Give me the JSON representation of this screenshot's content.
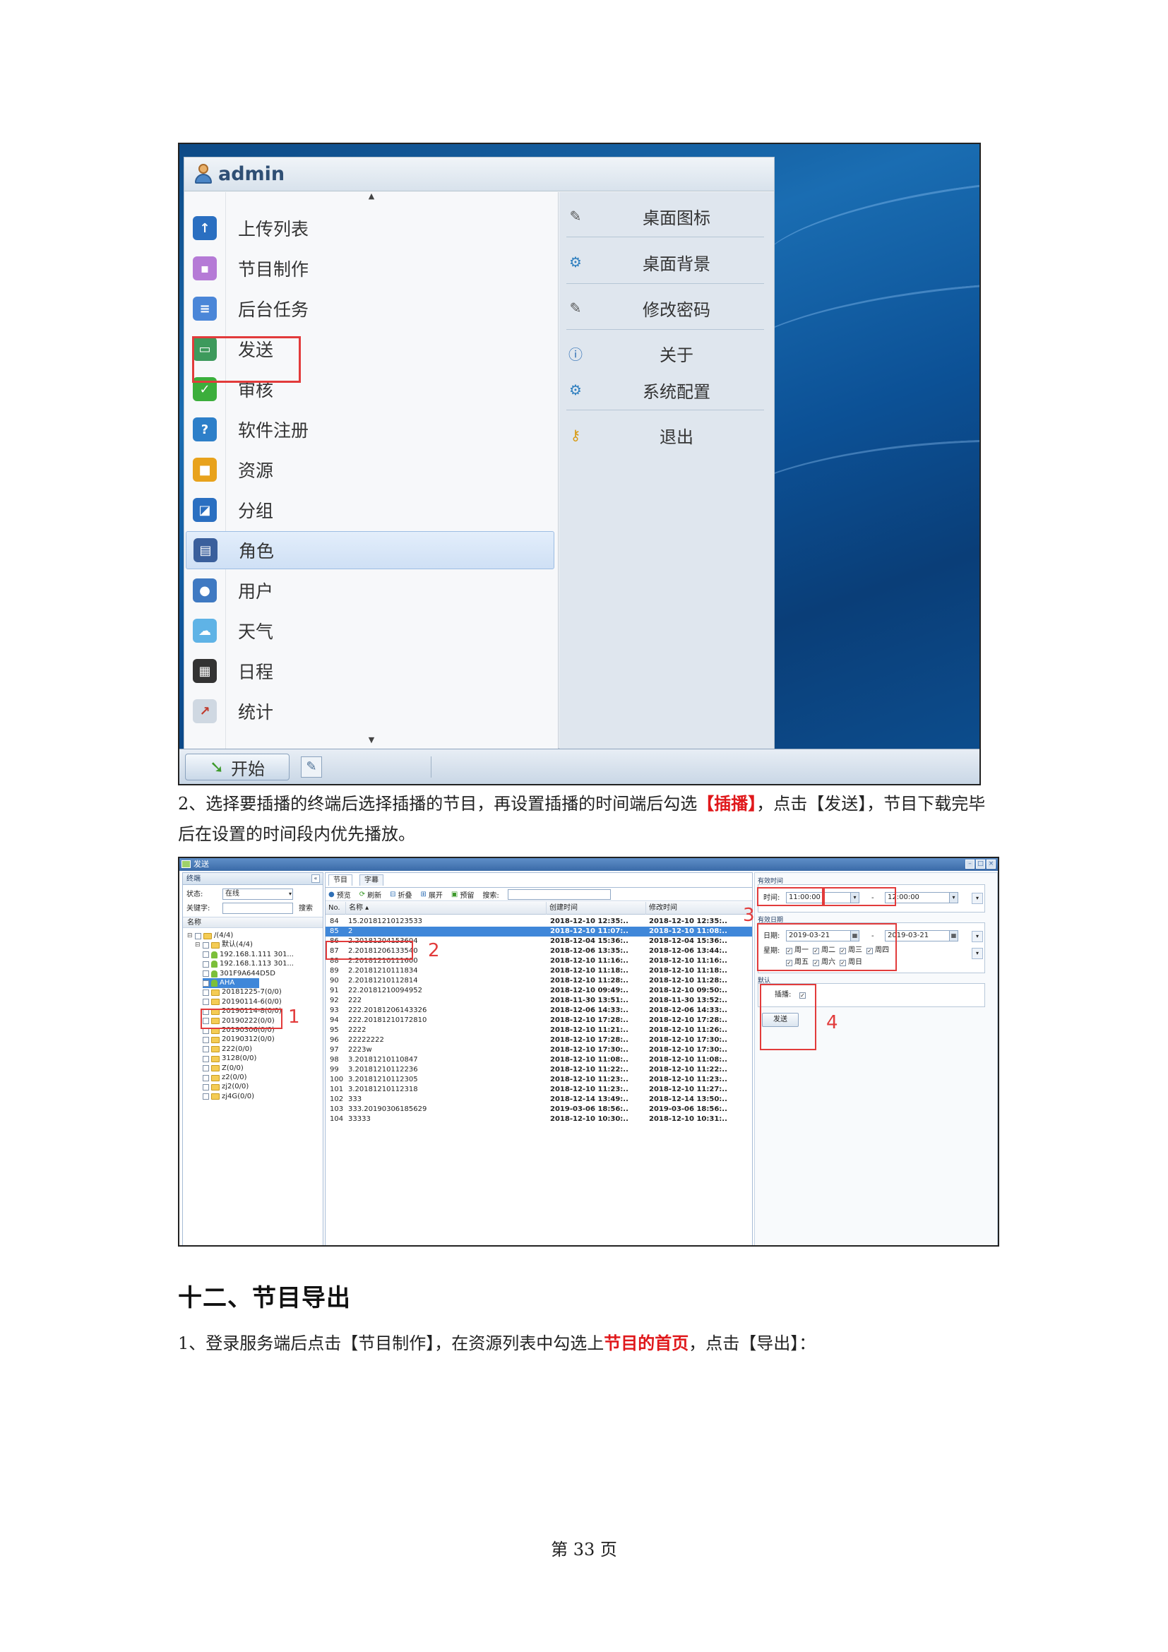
{
  "screenshot1": {
    "user_name": "admin",
    "scroll_up": "▲",
    "scroll_down": "▼",
    "left_menu": [
      {
        "label": "上传列表",
        "icon": "upload-icon"
      },
      {
        "label": "节目制作",
        "icon": "program-make-icon"
      },
      {
        "label": "后台任务",
        "icon": "task-icon"
      },
      {
        "label": "发送",
        "icon": "send-icon"
      },
      {
        "label": "审核",
        "icon": "check-icon"
      },
      {
        "label": "软件注册",
        "icon": "register-icon"
      },
      {
        "label": "资源",
        "icon": "resource-icon"
      },
      {
        "label": "分组",
        "icon": "group-icon"
      },
      {
        "label": "角色",
        "icon": "role-icon"
      },
      {
        "label": "用户",
        "icon": "user-icon"
      },
      {
        "label": "天气",
        "icon": "weather-icon"
      },
      {
        "label": "日程",
        "icon": "schedule-icon"
      },
      {
        "label": "统计",
        "icon": "stats-icon"
      }
    ],
    "right_menu": [
      {
        "label": "桌面图标",
        "icon": "edit-icon"
      },
      {
        "label": "桌面背景",
        "icon": "gear-icon"
      },
      {
        "label": "修改密码",
        "icon": "edit-icon"
      },
      {
        "label": "关于",
        "icon": "info-icon"
      },
      {
        "label": "系统配置",
        "icon": "gear-icon"
      },
      {
        "label": "退出",
        "icon": "key-icon"
      }
    ],
    "start_button": "开始"
  },
  "paragraph1": {
    "part1": "2、选择要插播的终端后选择插播的节目，再设置插播的时间端后勾选",
    "hl1": "【插播】",
    "part2": "，点击【发送】，节目下载完毕后在设置的时间段内优先播放。"
  },
  "screenshot2": {
    "title": "发送",
    "terminal_panel": {
      "header": "终端",
      "status_label": "状态:",
      "status_value": "在线",
      "keyword_label": "关键字:",
      "keyword_value": "",
      "search_button": "搜索",
      "name_header": "名称",
      "tree": [
        {
          "text": "/(4/4)",
          "level": 0,
          "kind": "folder",
          "checked": false
        },
        {
          "text": "默认(4/4)",
          "level": 1,
          "kind": "folder",
          "checked": false
        },
        {
          "text": "192.168.1.111 301...",
          "level": 2,
          "kind": "device",
          "checked": false
        },
        {
          "text": "192.168.1.113 301...",
          "level": 2,
          "kind": "device",
          "checked": false
        },
        {
          "text": "301F9A644D5D",
          "level": 2,
          "kind": "device",
          "checked": false
        },
        {
          "text": "AHA",
          "level": 2,
          "kind": "device",
          "checked": true
        },
        {
          "text": "20181225-7(0/0)",
          "level": 1,
          "kind": "folder",
          "checked": false
        },
        {
          "text": "20190114-6(0/0)",
          "level": 1,
          "kind": "folder",
          "checked": false
        },
        {
          "text": "20190114-8(0/0)",
          "level": 1,
          "kind": "folder",
          "checked": false
        },
        {
          "text": "20190222(0/0)",
          "level": 1,
          "kind": "folder",
          "checked": false
        },
        {
          "text": "20190306(0/0)",
          "level": 1,
          "kind": "folder",
          "checked": false
        },
        {
          "text": "20190312(0/0)",
          "level": 1,
          "kind": "folder",
          "checked": false
        },
        {
          "text": "222(0/0)",
          "level": 1,
          "kind": "folder",
          "checked": false
        },
        {
          "text": "3128(0/0)",
          "level": 1,
          "kind": "folder",
          "checked": false
        },
        {
          "text": "Z(0/0)",
          "level": 1,
          "kind": "folder",
          "checked": false
        },
        {
          "text": "z2(0/0)",
          "level": 1,
          "kind": "folder",
          "checked": false
        },
        {
          "text": "zj2(0/0)",
          "level": 1,
          "kind": "folder",
          "checked": false
        },
        {
          "text": "zj4G(0/0)",
          "level": 1,
          "kind": "folder",
          "checked": false
        }
      ]
    },
    "program_panel": {
      "tabs": [
        "节目",
        "字幕"
      ],
      "toolbar": [
        "预览",
        "刷新",
        "折叠",
        "展开",
        "预留"
      ],
      "search_label": "搜索:",
      "columns": [
        "No.",
        "名称 ▴",
        "创建时间",
        "修改时间"
      ],
      "rows": [
        {
          "no": "84",
          "name": "15.20181210123533",
          "created": "2018-12-10 12:35:..",
          "modified": "2018-12-10 12:35:.."
        },
        {
          "no": "85",
          "name": "2",
          "created": "2018-12-10 11:07:..",
          "modified": "2018-12-10 11:08:..",
          "selected": true
        },
        {
          "no": "86",
          "name": "2.20181204153604",
          "created": "2018-12-04 15:36:..",
          "modified": "2018-12-04 15:36:.."
        },
        {
          "no": "87",
          "name": "2.20181206133540",
          "created": "2018-12-06 13:35:..",
          "modified": "2018-12-06 13:44:.."
        },
        {
          "no": "88",
          "name": "2.20181210111600",
          "created": "2018-12-10 11:16:..",
          "modified": "2018-12-10 11:16:.."
        },
        {
          "no": "89",
          "name": "2.20181210111834",
          "created": "2018-12-10 11:18:..",
          "modified": "2018-12-10 11:18:.."
        },
        {
          "no": "90",
          "name": "2.20181210112814",
          "created": "2018-12-10 11:28:..",
          "modified": "2018-12-10 11:28:.."
        },
        {
          "no": "91",
          "name": "22.20181210094952",
          "created": "2018-12-10 09:49:..",
          "modified": "2018-12-10 09:50:.."
        },
        {
          "no": "92",
          "name": "222",
          "created": "2018-11-30 13:51:..",
          "modified": "2018-11-30 13:52:.."
        },
        {
          "no": "93",
          "name": "222.20181206143326",
          "created": "2018-12-06 14:33:..",
          "modified": "2018-12-06 14:33:.."
        },
        {
          "no": "94",
          "name": "222.20181210172810",
          "created": "2018-12-10 17:28:..",
          "modified": "2018-12-10 17:28:.."
        },
        {
          "no": "95",
          "name": "2222",
          "created": "2018-12-10 11:21:..",
          "modified": "2018-12-10 11:26:.."
        },
        {
          "no": "96",
          "name": "22222222",
          "created": "2018-12-10 17:28:..",
          "modified": "2018-12-10 17:30:.."
        },
        {
          "no": "97",
          "name": "2223w",
          "created": "2018-12-10 17:30:..",
          "modified": "2018-12-10 17:30:.."
        },
        {
          "no": "98",
          "name": "3.20181210110847",
          "created": "2018-12-10 11:08:..",
          "modified": "2018-12-10 11:08:.."
        },
        {
          "no": "99",
          "name": "3.20181210112236",
          "created": "2018-12-10 11:22:..",
          "modified": "2018-12-10 11:22:.."
        },
        {
          "no": "100",
          "name": "3.20181210112305",
          "created": "2018-12-10 11:23:..",
          "modified": "2018-12-10 11:23:.."
        },
        {
          "no": "101",
          "name": "3.20181210112318",
          "created": "2018-12-10 11:23:..",
          "modified": "2018-12-10 11:27:.."
        },
        {
          "no": "102",
          "name": "333",
          "created": "2018-12-14 13:49:..",
          "modified": "2018-12-14 13:50:.."
        },
        {
          "no": "103",
          "name": "333.20190306185629",
          "created": "2019-03-06 18:56:..",
          "modified": "2019-03-06 18:56:.."
        },
        {
          "no": "104",
          "name": "33333",
          "created": "2018-12-10 10:30:..",
          "modified": "2018-12-10 10:31:.."
        }
      ]
    },
    "form": {
      "valid_time_legend": "有效时间",
      "time_label": "时间:",
      "time_from": "11:00:00",
      "time_sep": "-",
      "time_to": "12:00:00",
      "valid_date_legend": "有效日期",
      "date_label": "日期:",
      "date_from": "2019-03-21",
      "date_sep": "-",
      "date_to": "2019-03-21",
      "week_label": "星期:",
      "weekdays": [
        "周一",
        "周二",
        "周三",
        "周四",
        "周五",
        "周六",
        "周日"
      ],
      "default_legend": "默认",
      "insert_label": "插播:",
      "send_button": "发送"
    },
    "annotations": [
      "1",
      "2",
      "3",
      "4"
    ]
  },
  "section_heading": "十二、节目导出",
  "paragraph2": {
    "part1": "1、登录服务端后点击【节目制作】，在资源列表中勾选上",
    "hl1": "节目的首页",
    "part2": "，点击【导出】："
  },
  "page_number": "第 33 页"
}
